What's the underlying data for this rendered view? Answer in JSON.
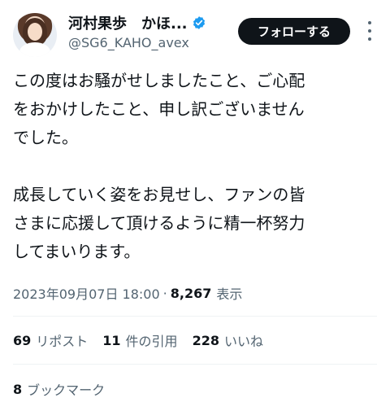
{
  "author": {
    "display_name": "河村果歩　かほ...",
    "handle": "@SG6_KAHO_avex",
    "verified_icon": "verified-badge-icon",
    "avatar_icon": "profile-avatar"
  },
  "header": {
    "follow_label": "フォローする",
    "more_icon": "more-vertical-icon"
  },
  "tweet": {
    "paragraphs": [
      "この度はお騒がせしましたこと、ご心配\nをおかけしたこと、申し訳ございません\nでした。",
      "成長していく姿をお見せし、ファンの皆\nさまに応援して頂けるように精一杯努力\nしてまいります。"
    ],
    "timestamp": "2023年09月07日 18:00",
    "separator": "·",
    "views_count": "8,267",
    "views_label": "表示"
  },
  "stats": {
    "reposts": {
      "count": "69",
      "label": "リポスト"
    },
    "quotes": {
      "count": "11",
      "label": "件の引用"
    },
    "likes": {
      "count": "228",
      "label": "いいね"
    },
    "bookmarks": {
      "count": "8",
      "label": "ブックマーク"
    }
  },
  "colors": {
    "text_primary": "#0f1419",
    "text_secondary": "#536471",
    "verified_blue": "#1d9bf0",
    "follow_button_bg": "#0f1419",
    "divider": "#eff3f4"
  }
}
